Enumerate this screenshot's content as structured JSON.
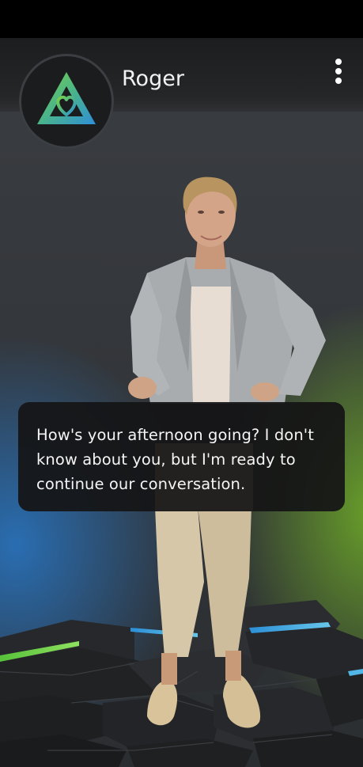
{
  "header": {
    "bot_name": "Roger",
    "menu_icon": "more-vertical-icon",
    "logo_icon": "triangle-heart-logo"
  },
  "character": {
    "description_icon": "avatar-character"
  },
  "message": {
    "text": "How's your afternoon going? I don't know about you, but I'm ready to continue our conversation."
  },
  "colors": {
    "accent_green": "#6ec63a",
    "accent_blue": "#3aa0d8",
    "bubble_bg": "#141415"
  }
}
